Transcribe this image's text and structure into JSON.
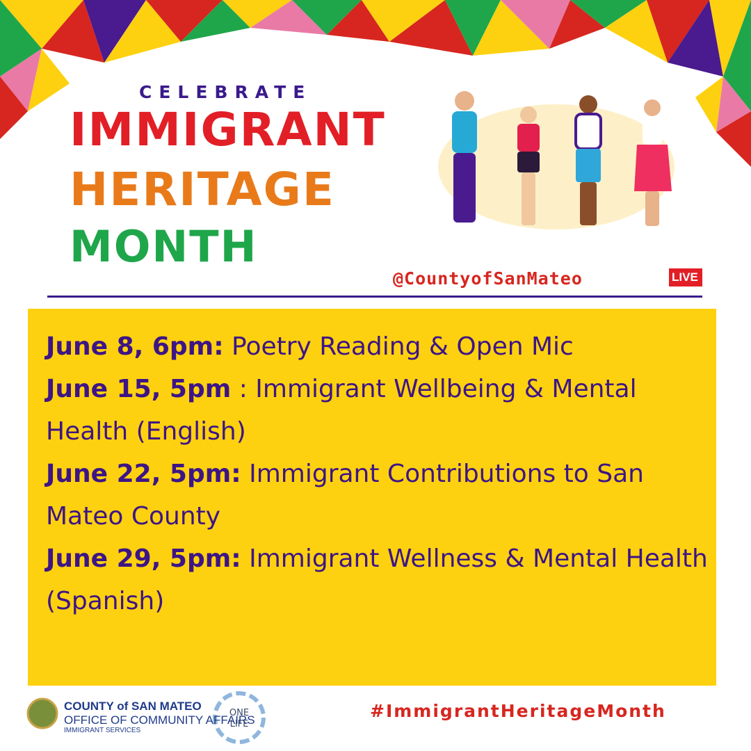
{
  "header": {
    "kicker": "CELEBRATE",
    "title_lines": [
      "IMMIGRANT",
      "HERITAGE",
      "MONTH"
    ]
  },
  "social": {
    "handle": "@CountyofSanMateo",
    "live_badge": "LIVE"
  },
  "events": [
    {
      "date": "June 8, 6pm:",
      "title": " Poetry Reading & Open Mic"
    },
    {
      "date": "June 15, 5pm",
      "title": " : Immigrant Wellbeing & Mental Health (English)"
    },
    {
      "date": "June 22, 5pm:",
      "title": " Immigrant Contributions to San Mateo County"
    },
    {
      "date": "June 29, 5pm:",
      "title": " Immigrant Wellness & Mental Health (Spanish)"
    }
  ],
  "footer": {
    "county_name": "COUNTY of SAN MATEO",
    "office": "OFFICE OF COMMUNITY AFFAIRS",
    "division": "IMMIGRANT SERVICES",
    "partner_logo_text": "ONE LIFE",
    "hashtag": "#ImmigrantHeritageMonth"
  },
  "colors": {
    "purple": "#3d1586",
    "yellow": "#fdd10f",
    "red": "#d7261f",
    "green": "#1fa64a",
    "pink": "#e97aa5"
  },
  "illustration": "four-people-holding-hands"
}
